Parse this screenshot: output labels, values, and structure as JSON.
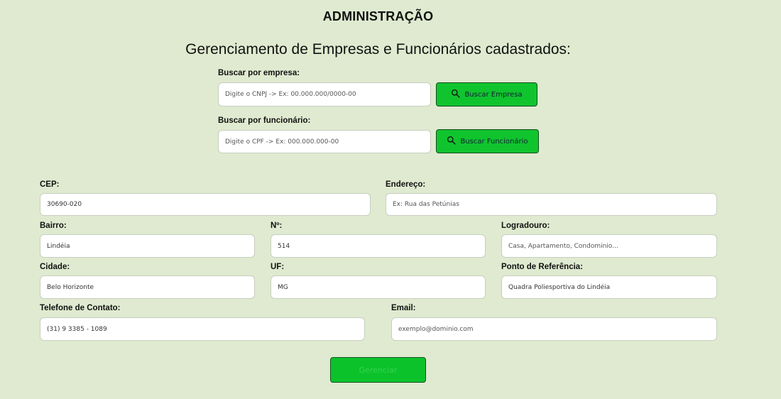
{
  "header": {
    "title": "ADMINISTRAÇÃO",
    "subtitle": "Gerenciamento de Empresas e Funcionários cadastrados:"
  },
  "search": {
    "company": {
      "label": "Buscar por empresa:",
      "placeholder": "Digite o CNPJ -> Ex: 00.000.000/0000-00",
      "button": "Buscar Empresa"
    },
    "employee": {
      "label": "Buscar por funcionário:",
      "placeholder": "Digite o CPF -> Ex: 000.000.000-00",
      "button": "Buscar Funcionário"
    }
  },
  "form": {
    "cep": {
      "label": "CEP:",
      "value": "30690-020"
    },
    "endereco": {
      "label": "Endereço:",
      "placeholder": "Ex: Rua das Petúnias"
    },
    "bairro": {
      "label": "Bairro:",
      "value": "Lindéia"
    },
    "numero": {
      "label": "Nº:",
      "value": "514"
    },
    "logradouro": {
      "label": "Logradouro:",
      "placeholder": "Casa, Apartamento, Condominio..."
    },
    "cidade": {
      "label": "Cidade:",
      "value": "Belo Horizonte"
    },
    "uf": {
      "label": "UF:",
      "value": "MG"
    },
    "referencia": {
      "label": "Ponto de Referência:",
      "value": "Quadra Poliesportiva do Lindéia"
    },
    "telefone": {
      "label": "Telefone de Contato:",
      "value": "(31) 9 3385 - 1089"
    },
    "email": {
      "label": "Email:",
      "placeholder": "exemplo@dominio.com"
    },
    "submit": "Gerenciar"
  },
  "colors": {
    "background": "#dfead0",
    "button": "#10c42e",
    "button_border": "#174b1f"
  },
  "icons": {
    "search": "search-icon"
  }
}
